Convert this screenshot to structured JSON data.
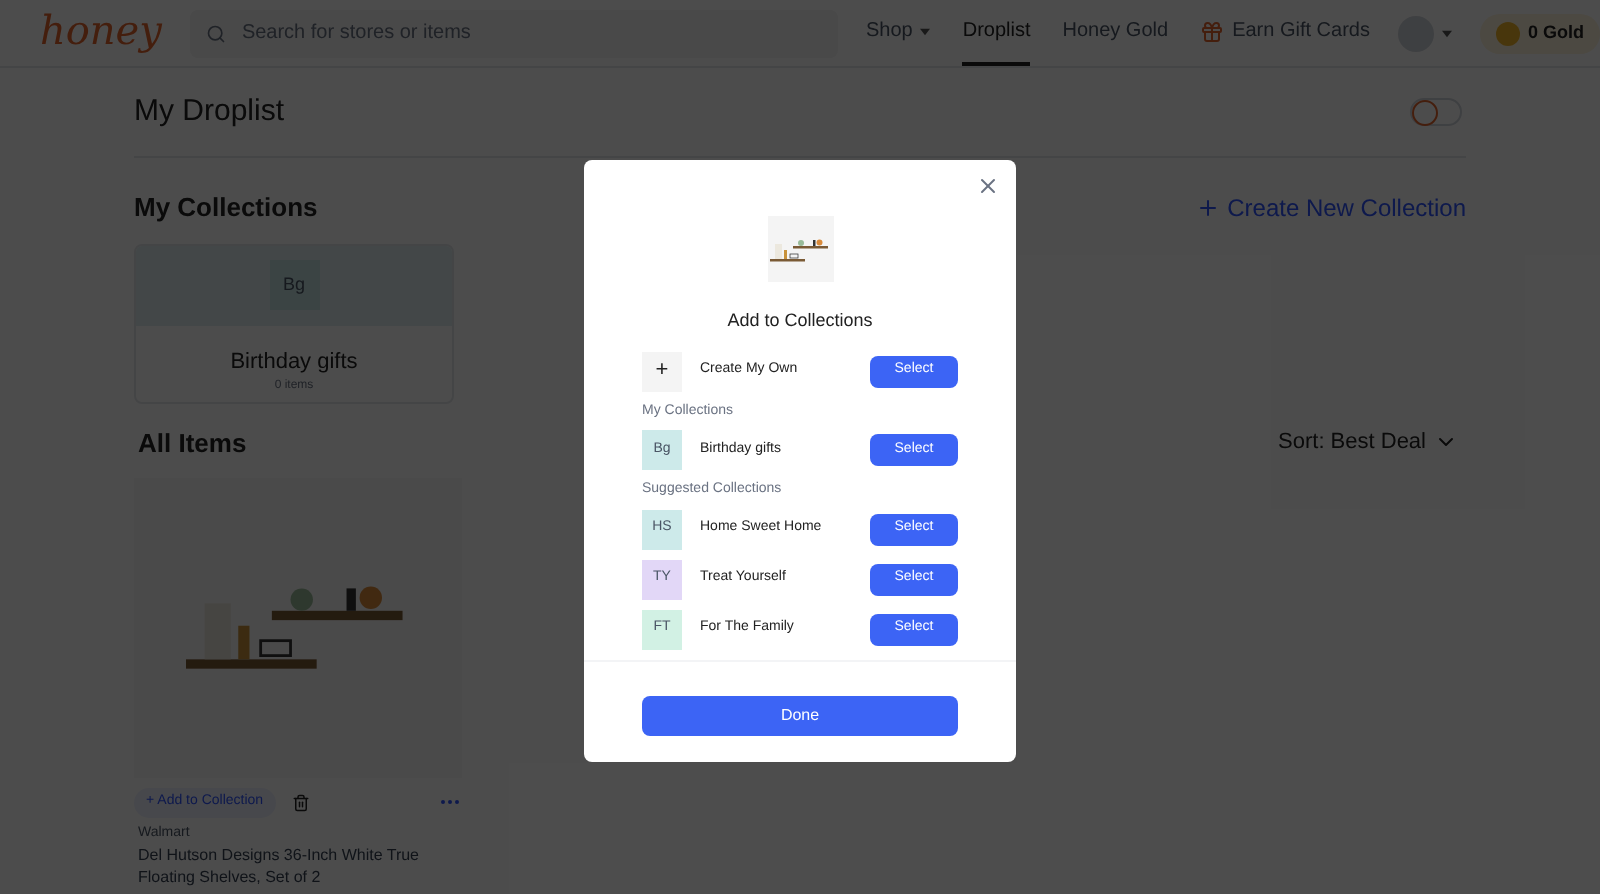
{
  "header": {
    "logo": "honey",
    "search": {
      "placeholder": "Search for stores or items"
    },
    "nav": [
      {
        "label": "Shop",
        "kind": "menu",
        "selected": false
      },
      {
        "label": "Droplist",
        "kind": "link",
        "selected": true
      },
      {
        "label": "Honey Gold",
        "kind": "link",
        "selected": false
      },
      {
        "label": "Earn Gift Cards",
        "kind": "gift",
        "selected": false
      }
    ],
    "gold": "0 Gold"
  },
  "page": {
    "title": "My Droplist",
    "toggle": {
      "on": false
    },
    "collections_heading": "My Collections",
    "create_link": "Create New Collection",
    "collections": [
      {
        "initials": "Bg",
        "name": "Birthday gifts",
        "count": "0 items"
      }
    ],
    "items_heading": "All Items",
    "sort": "Sort: Best Deal",
    "items": [
      {
        "add_label": "+ Add to Collection",
        "store": "Walmart",
        "title": "Del Hutson Designs 36-Inch White True Floating Shelves, Set of 2"
      }
    ]
  },
  "modal": {
    "title": "Add to Collections",
    "create": {
      "icon": "+",
      "label": "Create My Own",
      "button": "Select"
    },
    "sections": [
      {
        "heading": "My Collections",
        "rows": [
          {
            "initials": "Bg",
            "label": "Birthday gifts",
            "button": "Select",
            "color": "#cdeaea"
          }
        ]
      },
      {
        "heading": "Suggested Collections",
        "rows": [
          {
            "initials": "HS",
            "label": "Home Sweet Home",
            "button": "Select",
            "color": "#cdeaea"
          },
          {
            "initials": "TY",
            "label": "Treat Yourself",
            "button": "Select",
            "color": "#e2d7f7"
          },
          {
            "initials": "FT",
            "label": "For The Family",
            "button": "Select",
            "color": "#d2f1e4"
          }
        ]
      }
    ],
    "done": "Done"
  }
}
